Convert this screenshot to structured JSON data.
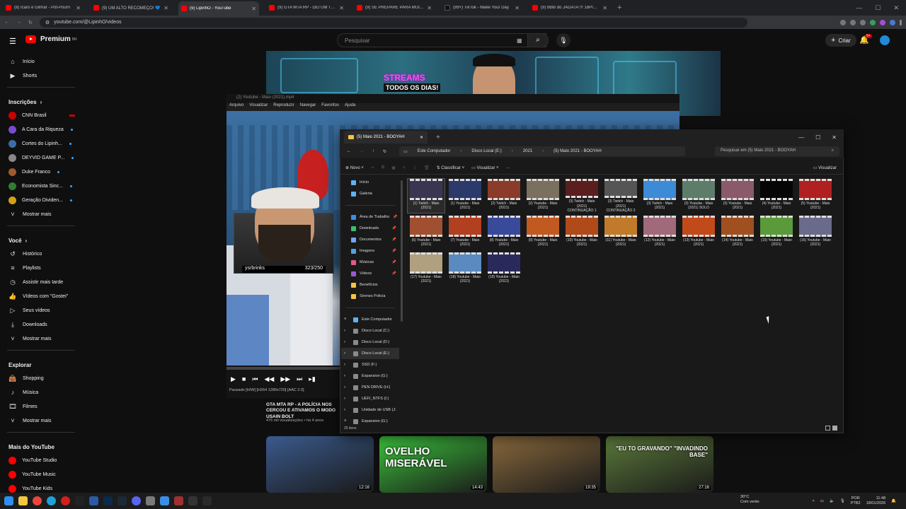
{
  "browser": {
    "tabs": [
      {
        "title": "(8) Ícaro e Gilmar - Pot-Pourri",
        "icon": "youtube-icon",
        "active": false
      },
      {
        "title": "(9) UM ALTO RECOMEÇO! 💙",
        "icon": "youtube-icon",
        "active": false
      },
      {
        "title": "(9) LipinhO - YouTube",
        "icon": "youtube-icon",
        "active": true
      },
      {
        "title": "(9) GTA MTA RP - DEI UM TAPA",
        "icon": "youtube-icon",
        "active": false
      },
      {
        "title": "(9) SE PREPARE PARA MUITA G",
        "icon": "youtube-icon",
        "active": false
      },
      {
        "title": "(99+) TikTok - Make Your Day",
        "icon": "tiktok-icon",
        "active": false
      },
      {
        "title": "(9) BBB do JAGATA !!! 18PINHO",
        "icon": "youtube-icon",
        "active": false
      }
    ],
    "url": "youtube.com/@LipinhO/videos"
  },
  "youtube": {
    "logo": "Premium",
    "logo_sup": "BR",
    "search_placeholder": "Pesquisar",
    "create_label": "Criar",
    "notifications": "9+",
    "sidebar": {
      "main": [
        {
          "label": "Início",
          "icon": "home-icon"
        },
        {
          "label": "Shorts",
          "icon": "shorts-icon"
        }
      ],
      "subs_title": "Inscrições",
      "subs": [
        {
          "label": "CNN Brasil",
          "color": "#cc0000",
          "live": true
        },
        {
          "label": "A Cara da Riqueza",
          "color": "#7a4bd1"
        },
        {
          "label": "Cortes do Lipinh...",
          "color": "#3b6ea5"
        },
        {
          "label": "DEYVID GAME P...",
          "color": "#888888"
        },
        {
          "label": "Duke Franco",
          "color": "#a05a2c"
        },
        {
          "label": "Economista Sinc...",
          "color": "#2e7d32"
        },
        {
          "label": "Geração Dividen...",
          "color": "#d4a017"
        },
        {
          "label": "Mostrar mais",
          "icon": "chevron-down-icon"
        }
      ],
      "you_title": "Você",
      "you": [
        {
          "label": "Histórico",
          "icon": "history-icon"
        },
        {
          "label": "Playlists",
          "icon": "playlist-icon"
        },
        {
          "label": "Assistir mais tarde",
          "icon": "clock-icon"
        },
        {
          "label": "Vídeos com \"Gostei\"",
          "icon": "like-icon"
        },
        {
          "label": "Seus vídeos",
          "icon": "video-icon"
        },
        {
          "label": "Downloads",
          "icon": "download-icon"
        },
        {
          "label": "Mostrar mais",
          "icon": "chevron-down-icon"
        }
      ],
      "explore_title": "Explorar",
      "explore": [
        {
          "label": "Shopping",
          "icon": "bag-icon"
        },
        {
          "label": "Música",
          "icon": "music-icon"
        },
        {
          "label": "Filmes",
          "icon": "film-icon"
        },
        {
          "label": "Mostrar mais",
          "icon": "chevron-down-icon"
        }
      ],
      "more_title": "Mais do YouTube",
      "more": [
        {
          "label": "YouTube Studio"
        },
        {
          "label": "YouTube Music"
        },
        {
          "label": "YouTube Kids"
        }
      ]
    },
    "banner": {
      "streams": "STREAMS",
      "todos": "TODOS OS DIAS!"
    },
    "video": {
      "title": "GTA MTA RP - A POLÍCIA NOS CERCOU E ATIVAMOS O MODO USAIN BOLT",
      "meta": "476 mil visualizações • há 4 anos"
    },
    "thumbs": [
      {
        "duration": "12:16",
        "color": "#3a5a8c",
        "text": ""
      },
      {
        "duration": "14:43",
        "color": "#3cc43c",
        "text": "OVELHO MISERÁVEL"
      },
      {
        "duration": "19:35",
        "color": "#8a6a3c",
        "text": ""
      },
      {
        "duration": "27:16",
        "color": "#5b7a3a",
        "text": "\"EU TO GRAVANDO\" \"INVADINDO BASE\""
      }
    ]
  },
  "player": {
    "window_title": "(2) Youtube - Maio (2021).mp4",
    "menu": [
      "Arquivo",
      "Visualizar",
      "Reproduzir",
      "Navegar",
      "Favoritos",
      "Ajuda"
    ],
    "cam_name": "ysrbrinks",
    "cam_count": "323/250",
    "status": "Pausado [H/W]   [H264 1280x720]   [AAC 2.0]"
  },
  "explorer": {
    "tab_title": "(5) Maio 2021 - BOOYAH",
    "breadcrumb": [
      "Este Computador",
      "Disco Local (E:)",
      "2021",
      "(5) Maio 2021 - BOOYAH"
    ],
    "search_placeholder": "Pesquisar em (5) Maio 2021 - BOOYAH",
    "toolbar": {
      "new": "Novo",
      "sort": "Classificar",
      "view": "Visualizar",
      "details": "Visualizar"
    },
    "nav": [
      {
        "label": "Início",
        "color": "#5fb2f2",
        "pin": false
      },
      {
        "label": "Galeria",
        "color": "#5fb2f2",
        "pin": false
      },
      {
        "label": "Área de Trabalho",
        "color": "#3a8ee6",
        "pin": true
      },
      {
        "label": "Downloads",
        "color": "#3ac06a",
        "pin": true
      },
      {
        "label": "Documentos",
        "color": "#6ea8ff",
        "pin": true
      },
      {
        "label": "Imagens",
        "color": "#4fa3e0",
        "pin": true
      },
      {
        "label": "Músicas",
        "color": "#e05a8a",
        "pin": true
      },
      {
        "label": "Vídeos",
        "color": "#9b59d0",
        "pin": true
      },
      {
        "label": "Benefícios",
        "color": "#f4c542",
        "pin": false
      },
      {
        "label": "Sirenes Policia",
        "color": "#f4c542",
        "pin": false
      }
    ],
    "drives": [
      {
        "label": "Este Computador"
      },
      {
        "label": "Disco Local (C:)"
      },
      {
        "label": "Disco Local (D:)"
      },
      {
        "label": "Disco Local (E:)"
      },
      {
        "label": "SSD (F:)"
      },
      {
        "label": "Expansion (G:)"
      },
      {
        "label": "PEN DRIVE (H:)"
      },
      {
        "label": "UEFI_NTFS (I:)"
      },
      {
        "label": "Unidade de USB (J:"
      },
      {
        "label": "Expansion (G:)"
      }
    ],
    "files": [
      {
        "name": "(1) Twitch - Maio (2021)",
        "color": "#3a3550"
      },
      {
        "name": "(1) Youtube - Maio (2021)",
        "color": "#2b3a6b"
      },
      {
        "name": "(2) Twitch - Maio (2021)",
        "color": "#8a3b2a"
      },
      {
        "name": "(2) Youtube - Maio (2021)",
        "color": "#7a7060"
      },
      {
        "name": "(3) Twitch - Maio (2021) CONTINUAÇÃO 1",
        "color": "#5a1e1e"
      },
      {
        "name": "(3) Twitch - Maio (2021) CONTINUAÇÃO 2",
        "color": "#555555"
      },
      {
        "name": "(3) Twitch - Maio (2021)",
        "color": "#3d8ad6"
      },
      {
        "name": "(3) Youtube - Maio (2021) SOLO",
        "color": "#5d7d6a"
      },
      {
        "name": "(3) Youtube - Maio (2021)",
        "color": "#8a5a6a"
      },
      {
        "name": "(4) Youtube - Maio (2021)",
        "color": "#050505"
      },
      {
        "name": "(5) Youtube - Maio (2021)",
        "color": "#b02020"
      },
      {
        "name": "(6) Youtube - Maio (2021)",
        "color": "#a05030"
      },
      {
        "name": "(7) Youtube - Maio (2021)",
        "color": "#b04020"
      },
      {
        "name": "(8) Youtube - Maio (2021)",
        "color": "#3a4a9a"
      },
      {
        "name": "(9) Youtube - Maio (2021)",
        "color": "#c05a20"
      },
      {
        "name": "(10) Youtube - Maio (2021)",
        "color": "#b04a1a"
      },
      {
        "name": "(11) Youtube - Maio (2021)",
        "color": "#c07a2a"
      },
      {
        "name": "(12) Youtube - Maio (2021)",
        "color": "#a06a7a"
      },
      {
        "name": "(13) Youtube - Maio (2021)",
        "color": "#c04a1a"
      },
      {
        "name": "(14) Youtube - Maio (2021)",
        "color": "#a05020"
      },
      {
        "name": "(15) Youtube - Maio (2021)",
        "color": "#5a9a3a"
      },
      {
        "name": "(16) Youtube - Maio (2021)",
        "color": "#6a6a8a"
      },
      {
        "name": "(17) Youtube - Maio (2021)",
        "color": "#b0a080"
      },
      {
        "name": "(18) Youtube - Maio (2021)",
        "color": "#5a8ac0"
      },
      {
        "name": "(19) Youtube - Maio (2021)",
        "color": "#2a2a5a"
      }
    ],
    "status": "25 itens"
  },
  "taskbar": {
    "weather_temp": "30°C",
    "weather_desc": "Com vento",
    "lang": "POR\nPTB2",
    "time": "11:48",
    "date": "18/01/2026"
  }
}
